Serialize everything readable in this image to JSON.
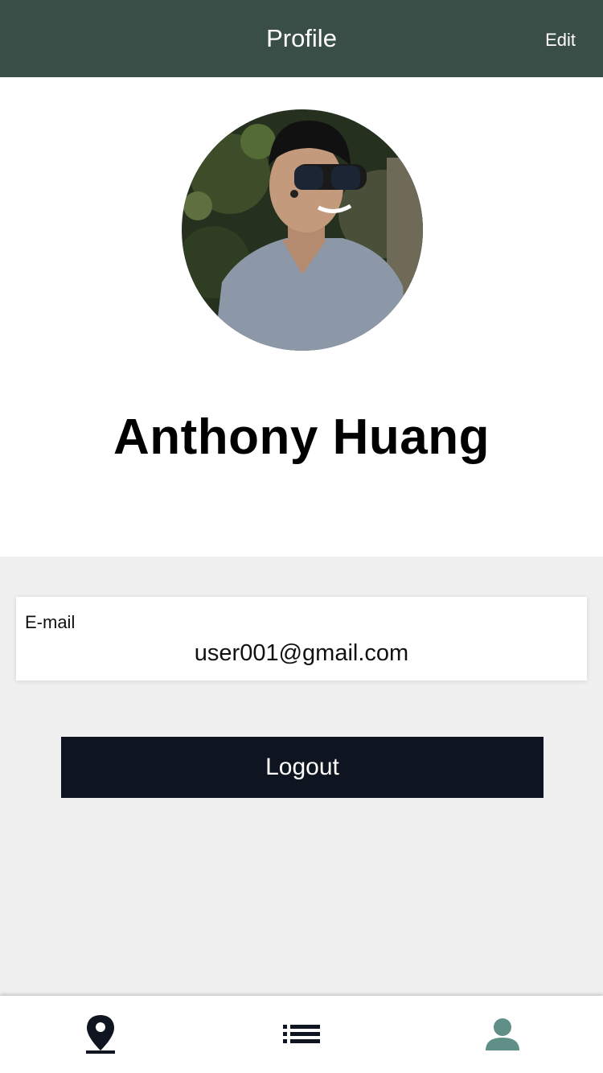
{
  "header": {
    "title": "Profile",
    "edit_label": "Edit"
  },
  "profile": {
    "name": "Anthony Huang",
    "avatar_icon": "user-photo"
  },
  "email": {
    "label": "E-mail",
    "value": "user001@gmail.com"
  },
  "actions": {
    "logout_label": "Logout"
  },
  "tab_bar": {
    "tabs": [
      {
        "icon": "map-pin-icon",
        "active": false
      },
      {
        "icon": "list-icon",
        "active": false
      },
      {
        "icon": "person-icon",
        "active": true
      }
    ]
  },
  "colors": {
    "header_bg": "#3a4e48",
    "button_bg": "#0f1520",
    "active_tab": "#5f8f86",
    "page_bg": "#f0f0f0"
  }
}
